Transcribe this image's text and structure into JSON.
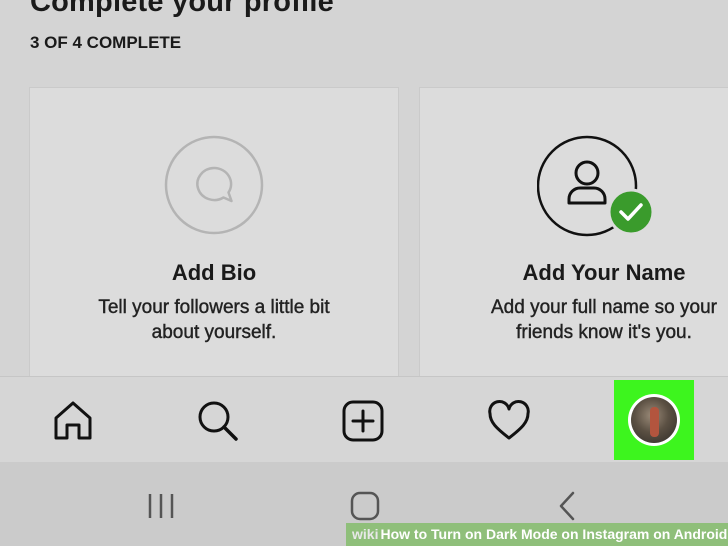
{
  "header": {
    "title": "Complete your profile",
    "progress": "3 OF 4 COMPLETE"
  },
  "cards": [
    {
      "title": "Add Bio",
      "description": "Tell your followers a little bit\nabout yourself.",
      "icon": "speech-bubble-icon",
      "completed": false
    },
    {
      "title": "Add Your Name",
      "description": "Add your full name so your\nfriends know it's you.",
      "icon": "person-icon",
      "completed": true,
      "check_color": "#3a9b2c"
    }
  ],
  "tabbar": {
    "items": [
      "home-icon",
      "search-icon",
      "add-post-icon",
      "heart-icon",
      "profile-avatar"
    ],
    "highlight_color": "#3df51e"
  },
  "android_nav": {
    "items": [
      "recents-icon",
      "home-icon",
      "back-icon"
    ]
  },
  "watermark": {
    "brand": "wiki",
    "how": "How",
    "text": " to Turn on Dark Mode on Instagram on Android"
  }
}
